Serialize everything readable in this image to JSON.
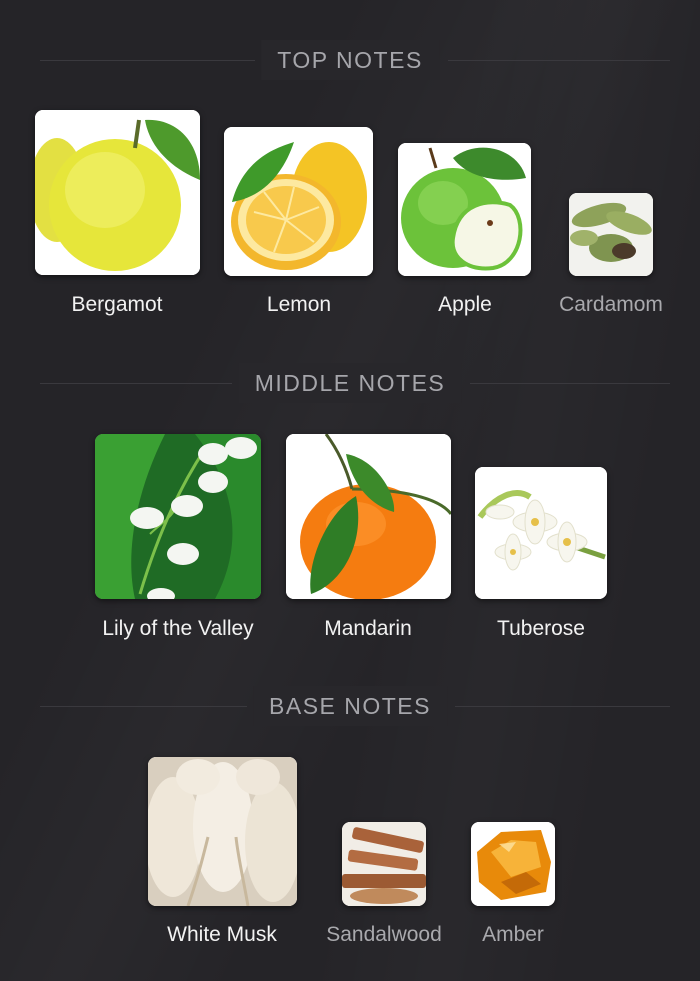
{
  "sections": [
    {
      "title": "TOP NOTES",
      "notes": [
        {
          "name": "Bergamot",
          "prominence": "primary"
        },
        {
          "name": "Lemon",
          "prominence": "primary"
        },
        {
          "name": "Apple",
          "prominence": "primary"
        },
        {
          "name": "Cardamom",
          "prominence": "secondary"
        }
      ]
    },
    {
      "title": "MIDDLE NOTES",
      "notes": [
        {
          "name": "Lily of the Valley",
          "prominence": "primary"
        },
        {
          "name": "Mandarin",
          "prominence": "primary"
        },
        {
          "name": "Tuberose",
          "prominence": "primary"
        }
      ]
    },
    {
      "title": "BASE NOTES",
      "notes": [
        {
          "name": "White Musk",
          "prominence": "primary"
        },
        {
          "name": "Sandalwood",
          "prominence": "secondary"
        },
        {
          "name": "Amber",
          "prominence": "secondary"
        }
      ]
    }
  ],
  "colors": {
    "background": "#252428",
    "heading": "#a6a6ab",
    "primary_label": "#f2f2f2",
    "secondary_label": "#a9a9ad"
  }
}
